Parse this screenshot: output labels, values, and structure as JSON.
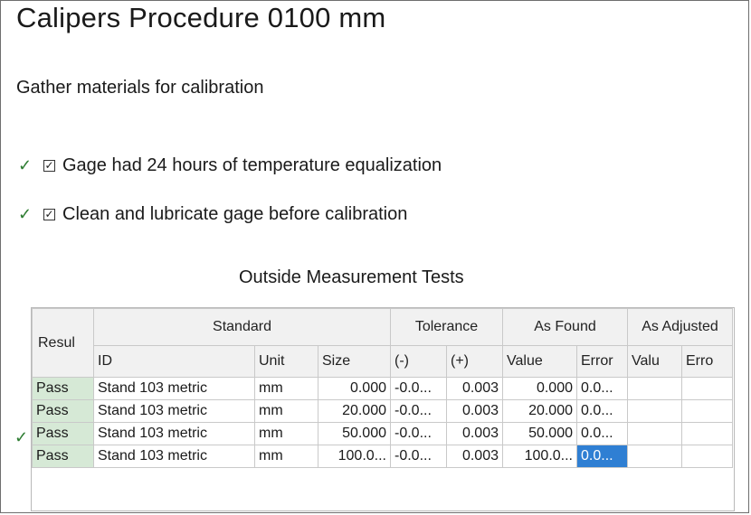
{
  "title": "Calipers Procedure 0100 mm",
  "gather_label": "Gather materials for calibration",
  "checklist": [
    {
      "label": "Gage had 24 hours of temperature equalization",
      "checked": true
    },
    {
      "label": "Clean and lubricate gage before calibration",
      "checked": true
    }
  ],
  "section_title": "Outside Measurement Tests",
  "table": {
    "group_headers": {
      "result": "Resul",
      "standard": "Standard",
      "tolerance": "Tolerance",
      "as_found": "As Found",
      "as_adjusted": "As Adjusted"
    },
    "columns": {
      "id": "ID",
      "unit": "Unit",
      "size": "Size",
      "tol_minus": "(-)",
      "tol_plus": "(+)",
      "found_value": "Value",
      "found_error": "Error",
      "adj_value": "Valu",
      "adj_error": "Erro"
    },
    "rows": [
      {
        "result": "Pass",
        "id": "Stand 103 metric",
        "unit": "mm",
        "size": "0.000",
        "tol_minus": "-0.0...",
        "tol_plus": "0.003",
        "found_value": "0.000",
        "found_error": "0.0...",
        "adj_value": "",
        "adj_error": ""
      },
      {
        "result": "Pass",
        "id": "Stand 103 metric",
        "unit": "mm",
        "size": "20.000",
        "tol_minus": "-0.0...",
        "tol_plus": "0.003",
        "found_value": "20.000",
        "found_error": "0.0...",
        "adj_value": "",
        "adj_error": ""
      },
      {
        "result": "Pass",
        "id": "Stand 103 metric",
        "unit": "mm",
        "size": "50.000",
        "tol_minus": "-0.0...",
        "tol_plus": "0.003",
        "found_value": "50.000",
        "found_error": "0.0...",
        "adj_value": "",
        "adj_error": ""
      },
      {
        "result": "Pass",
        "id": "Stand 103 metric",
        "unit": "mm",
        "size": "100.0...",
        "tol_minus": "-0.0...",
        "tol_plus": "0.003",
        "found_value": "100.0...",
        "found_error": "0.0...",
        "adj_value": "",
        "adj_error": ""
      }
    ]
  },
  "icons": {
    "check_mark": "✓",
    "checkbox_checked": "☑"
  },
  "colors": {
    "pass_cell": "#d6e9d6",
    "selected_cell": "#2f7fd3",
    "check_mark": "#2e7d32"
  }
}
